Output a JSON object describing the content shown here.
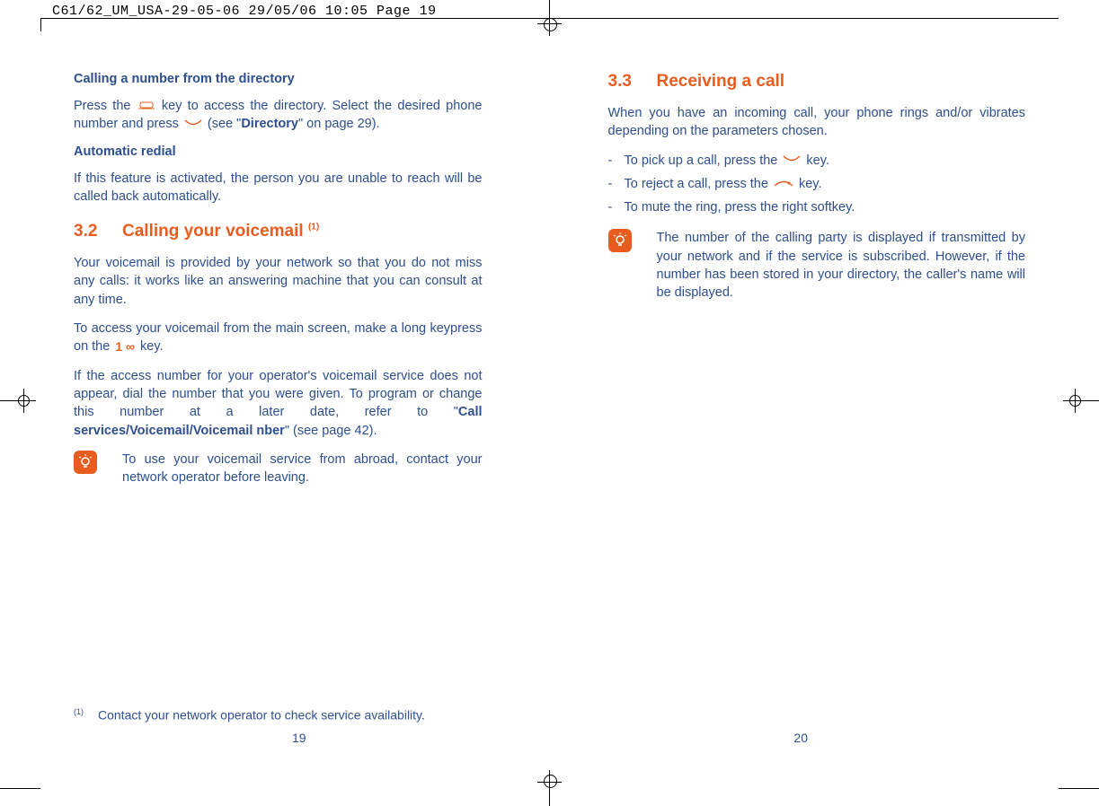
{
  "crop_header": "C61/62_UM_USA-29-05-06  29/05/06  10:05  Page 19",
  "left": {
    "h1": "Calling a number from the directory",
    "p1a": "Press the ",
    "p1b": " key to access the directory. Select the desired phone number and press ",
    "p1c": " (see \"",
    "p1_bold": "Directory",
    "p1d": "\" on page 29).",
    "h2": "Automatic redial",
    "p2": "If this feature is activated, the person you are unable to reach will be called back automatically.",
    "sec_num": "3.2",
    "sec_title": "Calling your voicemail ",
    "sec_sup": "(1)",
    "p3": "Your voicemail is provided by your network so that you do not miss any calls: it works like an answering machine that you can consult at any time.",
    "p4a": "To access your voicemail from the main screen, make a long keypress on the ",
    "p4b": " key.",
    "p5a": "If the access number for your operator's voicemail service does not appear, dial the number that you were given. To program or change this number at a later date, refer to \"",
    "p5_bold": "Call services/Voicemail/Voicemail nber",
    "p5b": "\" (see page 42).",
    "note": "To use your voicemail service from abroad, contact your network operator before leaving.",
    "footnote_mark": "(1)",
    "footnote": "Contact your network operator to check service availability.",
    "page": "19"
  },
  "right": {
    "sec_num": "3.3",
    "sec_title": "Receiving a call",
    "p1": "When you have an incoming call, your phone rings and/or vibrates depending on the parameters chosen.",
    "b1a": "To pick up a call, press the ",
    "b1b": " key.",
    "b2a": "To reject a call, press the ",
    "b2b": " key.",
    "b3": "To mute the ring, press the right softkey.",
    "note": "The number of the calling party is displayed if transmitted by your network and if the service is subscribed. However, if the number has been stored in your directory, the caller's name will be displayed.",
    "page": "20"
  }
}
